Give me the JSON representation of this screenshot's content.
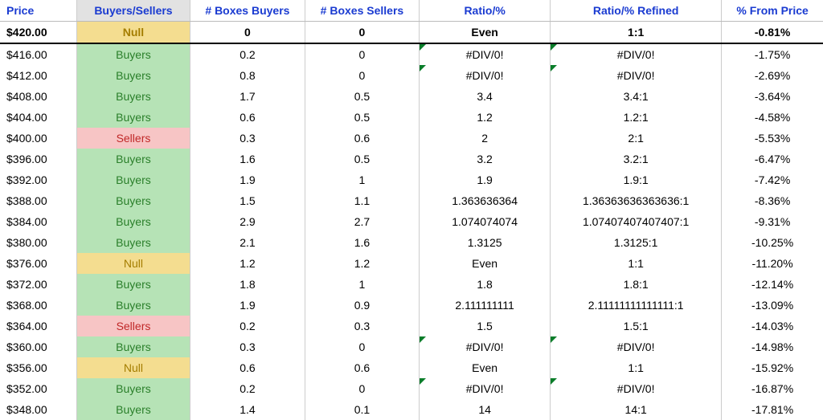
{
  "headers": {
    "price": "Price",
    "bs": "Buyers/Sellers",
    "bb": "# Boxes Buyers",
    "bsell": "# Boxes Sellers",
    "ratio": "Ratio/%",
    "ref": "Ratio/% Refined",
    "pct": "% From Price"
  },
  "rows": [
    {
      "price": "$420.00",
      "bs": "Null",
      "bb": "0",
      "bsell": "0",
      "ratio": "Even",
      "ref": "1:1",
      "pct": "-0.81%",
      "bold": true,
      "err": false
    },
    {
      "price": "$416.00",
      "bs": "Buyers",
      "bb": "0.2",
      "bsell": "0",
      "ratio": "#DIV/0!",
      "ref": "#DIV/0!",
      "pct": "-1.75%",
      "bold": false,
      "err": true
    },
    {
      "price": "$412.00",
      "bs": "Buyers",
      "bb": "0.8",
      "bsell": "0",
      "ratio": "#DIV/0!",
      "ref": "#DIV/0!",
      "pct": "-2.69%",
      "bold": false,
      "err": true
    },
    {
      "price": "$408.00",
      "bs": "Buyers",
      "bb": "1.7",
      "bsell": "0.5",
      "ratio": "3.4",
      "ref": "3.4:1",
      "pct": "-3.64%",
      "bold": false,
      "err": false
    },
    {
      "price": "$404.00",
      "bs": "Buyers",
      "bb": "0.6",
      "bsell": "0.5",
      "ratio": "1.2",
      "ref": "1.2:1",
      "pct": "-4.58%",
      "bold": false,
      "err": false
    },
    {
      "price": "$400.00",
      "bs": "Sellers",
      "bb": "0.3",
      "bsell": "0.6",
      "ratio": "2",
      "ref": "2:1",
      "pct": "-5.53%",
      "bold": false,
      "err": false
    },
    {
      "price": "$396.00",
      "bs": "Buyers",
      "bb": "1.6",
      "bsell": "0.5",
      "ratio": "3.2",
      "ref": "3.2:1",
      "pct": "-6.47%",
      "bold": false,
      "err": false
    },
    {
      "price": "$392.00",
      "bs": "Buyers",
      "bb": "1.9",
      "bsell": "1",
      "ratio": "1.9",
      "ref": "1.9:1",
      "pct": "-7.42%",
      "bold": false,
      "err": false
    },
    {
      "price": "$388.00",
      "bs": "Buyers",
      "bb": "1.5",
      "bsell": "1.1",
      "ratio": "1.363636364",
      "ref": "1.36363636363636:1",
      "pct": "-8.36%",
      "bold": false,
      "err": false
    },
    {
      "price": "$384.00",
      "bs": "Buyers",
      "bb": "2.9",
      "bsell": "2.7",
      "ratio": "1.074074074",
      "ref": "1.07407407407407:1",
      "pct": "-9.31%",
      "bold": false,
      "err": false
    },
    {
      "price": "$380.00",
      "bs": "Buyers",
      "bb": "2.1",
      "bsell": "1.6",
      "ratio": "1.3125",
      "ref": "1.3125:1",
      "pct": "-10.25%",
      "bold": false,
      "err": false
    },
    {
      "price": "$376.00",
      "bs": "Null",
      "bb": "1.2",
      "bsell": "1.2",
      "ratio": "Even",
      "ref": "1:1",
      "pct": "-11.20%",
      "bold": false,
      "err": false
    },
    {
      "price": "$372.00",
      "bs": "Buyers",
      "bb": "1.8",
      "bsell": "1",
      "ratio": "1.8",
      "ref": "1.8:1",
      "pct": "-12.14%",
      "bold": false,
      "err": false
    },
    {
      "price": "$368.00",
      "bs": "Buyers",
      "bb": "1.9",
      "bsell": "0.9",
      "ratio": "2.111111111",
      "ref": "2.11111111111111:1",
      "pct": "-13.09%",
      "bold": false,
      "err": false
    },
    {
      "price": "$364.00",
      "bs": "Sellers",
      "bb": "0.2",
      "bsell": "0.3",
      "ratio": "1.5",
      "ref": "1.5:1",
      "pct": "-14.03%",
      "bold": false,
      "err": false
    },
    {
      "price": "$360.00",
      "bs": "Buyers",
      "bb": "0.3",
      "bsell": "0",
      "ratio": "#DIV/0!",
      "ref": "#DIV/0!",
      "pct": "-14.98%",
      "bold": false,
      "err": true
    },
    {
      "price": "$356.00",
      "bs": "Null",
      "bb": "0.6",
      "bsell": "0.6",
      "ratio": "Even",
      "ref": "1:1",
      "pct": "-15.92%",
      "bold": false,
      "err": false
    },
    {
      "price": "$352.00",
      "bs": "Buyers",
      "bb": "0.2",
      "bsell": "0",
      "ratio": "#DIV/0!",
      "ref": "#DIV/0!",
      "pct": "-16.87%",
      "bold": false,
      "err": true
    },
    {
      "price": "$348.00",
      "bs": "Buyers",
      "bb": "1.4",
      "bsell": "0.1",
      "ratio": "14",
      "ref": "14:1",
      "pct": "-17.81%",
      "bold": false,
      "err": false
    }
  ]
}
